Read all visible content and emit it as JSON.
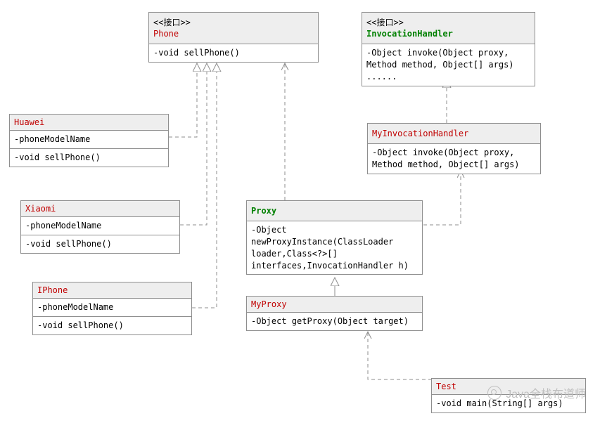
{
  "phone": {
    "stereo": "<<接口>>",
    "name": "Phone",
    "ops": "-void sellPhone()"
  },
  "invocationHandler": {
    "stereo": "<<接口>>",
    "name": "InvocationHandler",
    "ops": "-Object invoke(Object proxy, Method method, Object[] args)\n......"
  },
  "huawei": {
    "name": "Huawei",
    "attrs": "-phoneModelName",
    "ops": "-void sellPhone()"
  },
  "xiaomi": {
    "name": "Xiaomi",
    "attrs": "-phoneModelName",
    "ops": "-void sellPhone()"
  },
  "iphone": {
    "name": "IPhone",
    "attrs": "-phoneModelName",
    "ops": "-void sellPhone()"
  },
  "myInvocationHandler": {
    "name": "MyInvocationHandler",
    "ops": "-Object invoke(Object proxy, Method method, Object[] args)"
  },
  "proxy": {
    "name": "Proxy",
    "ops": "-Object newProxyInstance(ClassLoader loader,Class<?>[] interfaces,InvocationHandler h)"
  },
  "myProxy": {
    "name": "MyProxy",
    "ops": "-Object getProxy(Object target)"
  },
  "test": {
    "name": "Test",
    "ops": "-void main(String[] args)"
  },
  "watermark": "Java全栈布道师"
}
